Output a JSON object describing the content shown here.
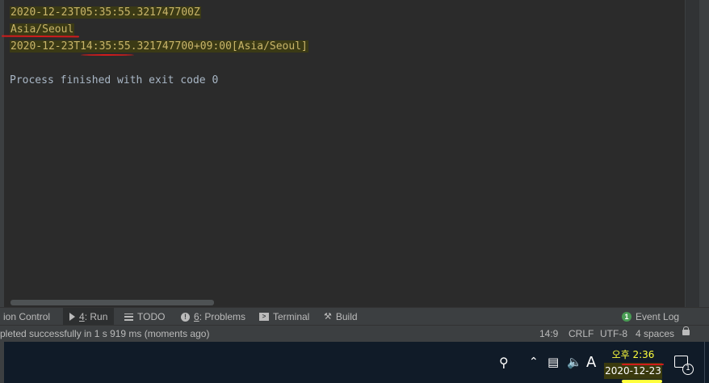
{
  "console": {
    "line1": "2020-12-23T05:35:55.321747700Z",
    "line2": "Asia/Seoul",
    "line3": "2020-12-23T14:35:55.321747700+09:00[Asia/Seoul]",
    "line4": "Process finished with exit code 0"
  },
  "toolbar": {
    "version_control": "ion Control",
    "run_num": "4",
    "run_label": ": Run",
    "todo": "TODO",
    "problems_num": "6",
    "problems_label": ": Problems",
    "terminal": "Terminal",
    "build": "Build",
    "event_count": "1",
    "event_log": "Event Log"
  },
  "statusbar": {
    "message": "pleted successfully in 1 s 919 ms (moments ago)",
    "position": "14:9",
    "line_sep": "CRLF",
    "encoding": "UTF-8",
    "indent": "4 spaces"
  },
  "taskbar": {
    "ime": "A",
    "time": "오후 2:36",
    "date": "2020-12-23",
    "notification_count": "1"
  },
  "colors": {
    "console_bg": "#2b2b2b",
    "highlight_text": "#c9b56a",
    "annotation_red": "#d01c1c",
    "event_green": "#499c54",
    "taskbar_bg": "#101b28"
  },
  "icons": [
    "run-icon",
    "todo-icon",
    "problems-icon",
    "terminal-icon",
    "build-icon",
    "event-log-icon",
    "lock-icon",
    "people-icon",
    "chevron-up-icon",
    "network-icon",
    "volume-icon",
    "notification-icon"
  ]
}
